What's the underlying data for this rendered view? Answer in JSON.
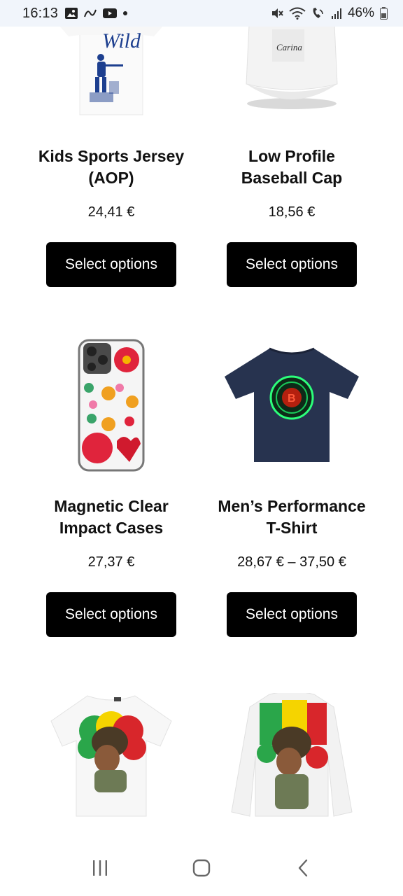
{
  "status_bar": {
    "time": "16:13",
    "battery_percent": "46%",
    "left_icons": [
      "gallery-icon",
      "link-icon",
      "youtube-icon",
      "dot-icon"
    ],
    "right_icons": [
      "mute-icon",
      "wifi-icon",
      "call-signal-icon",
      "cell-signal-icon",
      "battery-icon"
    ]
  },
  "products": [
    {
      "title_line1": "Kids Sports Jersey",
      "title_line2": "(AOP)",
      "price": "24,41 €",
      "button": "Select options",
      "image": "kids-jersey-image",
      "print_text": "Wild"
    },
    {
      "title_line1": "Low Profile",
      "title_line2": "Baseball Cap",
      "price": "18,56 €",
      "button": "Select options",
      "image": "baseball-cap-image",
      "print_text": "Carina"
    },
    {
      "title_line1": "Magnetic Clear",
      "title_line2": "Impact Cases",
      "price": "27,37 €",
      "button": "Select options",
      "image": "phone-case-image"
    },
    {
      "title_line1": "Men’s Performance",
      "title_line2": "T-Shirt",
      "price": "28,67 € – 37,50 €",
      "button": "Select options",
      "image": "performance-tshirt-image"
    },
    {
      "image": "rasta-tshirt-image"
    },
    {
      "image": "rasta-hoodie-image"
    }
  ],
  "nav_bar": {
    "icons": [
      "recent-apps-icon",
      "home-icon",
      "back-icon"
    ]
  }
}
